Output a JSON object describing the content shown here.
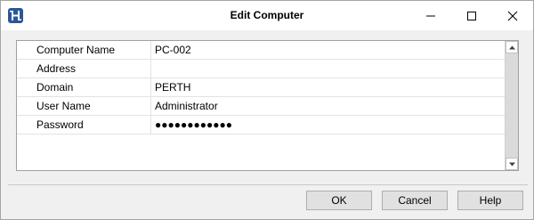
{
  "window": {
    "title": "Edit Computer"
  },
  "properties": [
    {
      "name": "Computer Name",
      "value": "PC-002"
    },
    {
      "name": "Address",
      "value": ""
    },
    {
      "name": "Domain",
      "value": "PERTH"
    },
    {
      "name": "User Name",
      "value": "Administrator"
    },
    {
      "name": "Password",
      "value": "●●●●●●●●●●●●"
    }
  ],
  "buttons": {
    "ok": "OK",
    "cancel": "Cancel",
    "help": "Help"
  },
  "icons": {
    "app": "app-logo-icon",
    "minimize": "minimize-icon",
    "maximize": "maximize-icon",
    "close": "close-icon",
    "scroll_up": "chevron-up-icon",
    "scroll_down": "chevron-down-icon"
  },
  "colors": {
    "app_icon": "#2b5797"
  }
}
